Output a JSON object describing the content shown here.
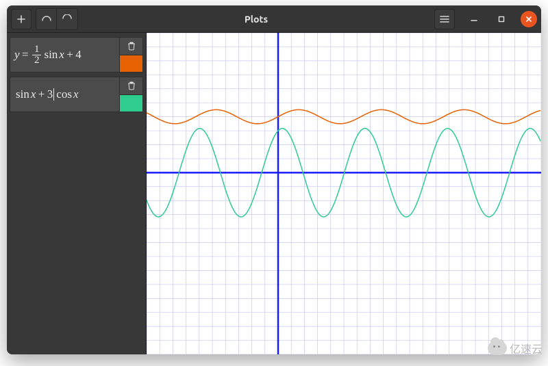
{
  "window": {
    "title": "Plots"
  },
  "toolbar": {
    "add_tooltip": "Add",
    "undo_tooltip": "Undo",
    "redo_tooltip": "Redo",
    "menu_tooltip": "Menu",
    "minimize_tooltip": "Minimize",
    "maximize_tooltip": "Maximize",
    "close_tooltip": "Close"
  },
  "equations": [
    {
      "display_raw": "y = 1/2 sin x + 4",
      "tokens": [
        "y",
        "=",
        "FRAC:1:2",
        "fn:sin",
        "it:x",
        "+",
        "4"
      ],
      "color": "#e86100",
      "delete_label": "Delete"
    },
    {
      "display_raw": "sin x + 3 cos x",
      "tokens": [
        "fn:sin",
        "it:x",
        "+",
        "3",
        "CURSOR",
        "fn:cos",
        "it:x"
      ],
      "color": "#2ecc8f",
      "delete_label": "Delete"
    }
  ],
  "chart_data": {
    "type": "line",
    "xlim": [
      -10,
      20
    ],
    "ylim": [
      -13,
      10
    ],
    "grid": true,
    "grid_spacing": 1,
    "axis_color": "#1a1aff",
    "grid_color": "#c8c8f0",
    "series": [
      {
        "name": "y = 1/2 sin x + 4",
        "color": "#e86100",
        "fn": "0.5*sin(x)+4"
      },
      {
        "name": "sin x + 3 cos x",
        "color": "#2ecc8f",
        "fn": "sin(x)+3*cos(x)"
      }
    ]
  },
  "watermark": {
    "text": "亿速云"
  }
}
